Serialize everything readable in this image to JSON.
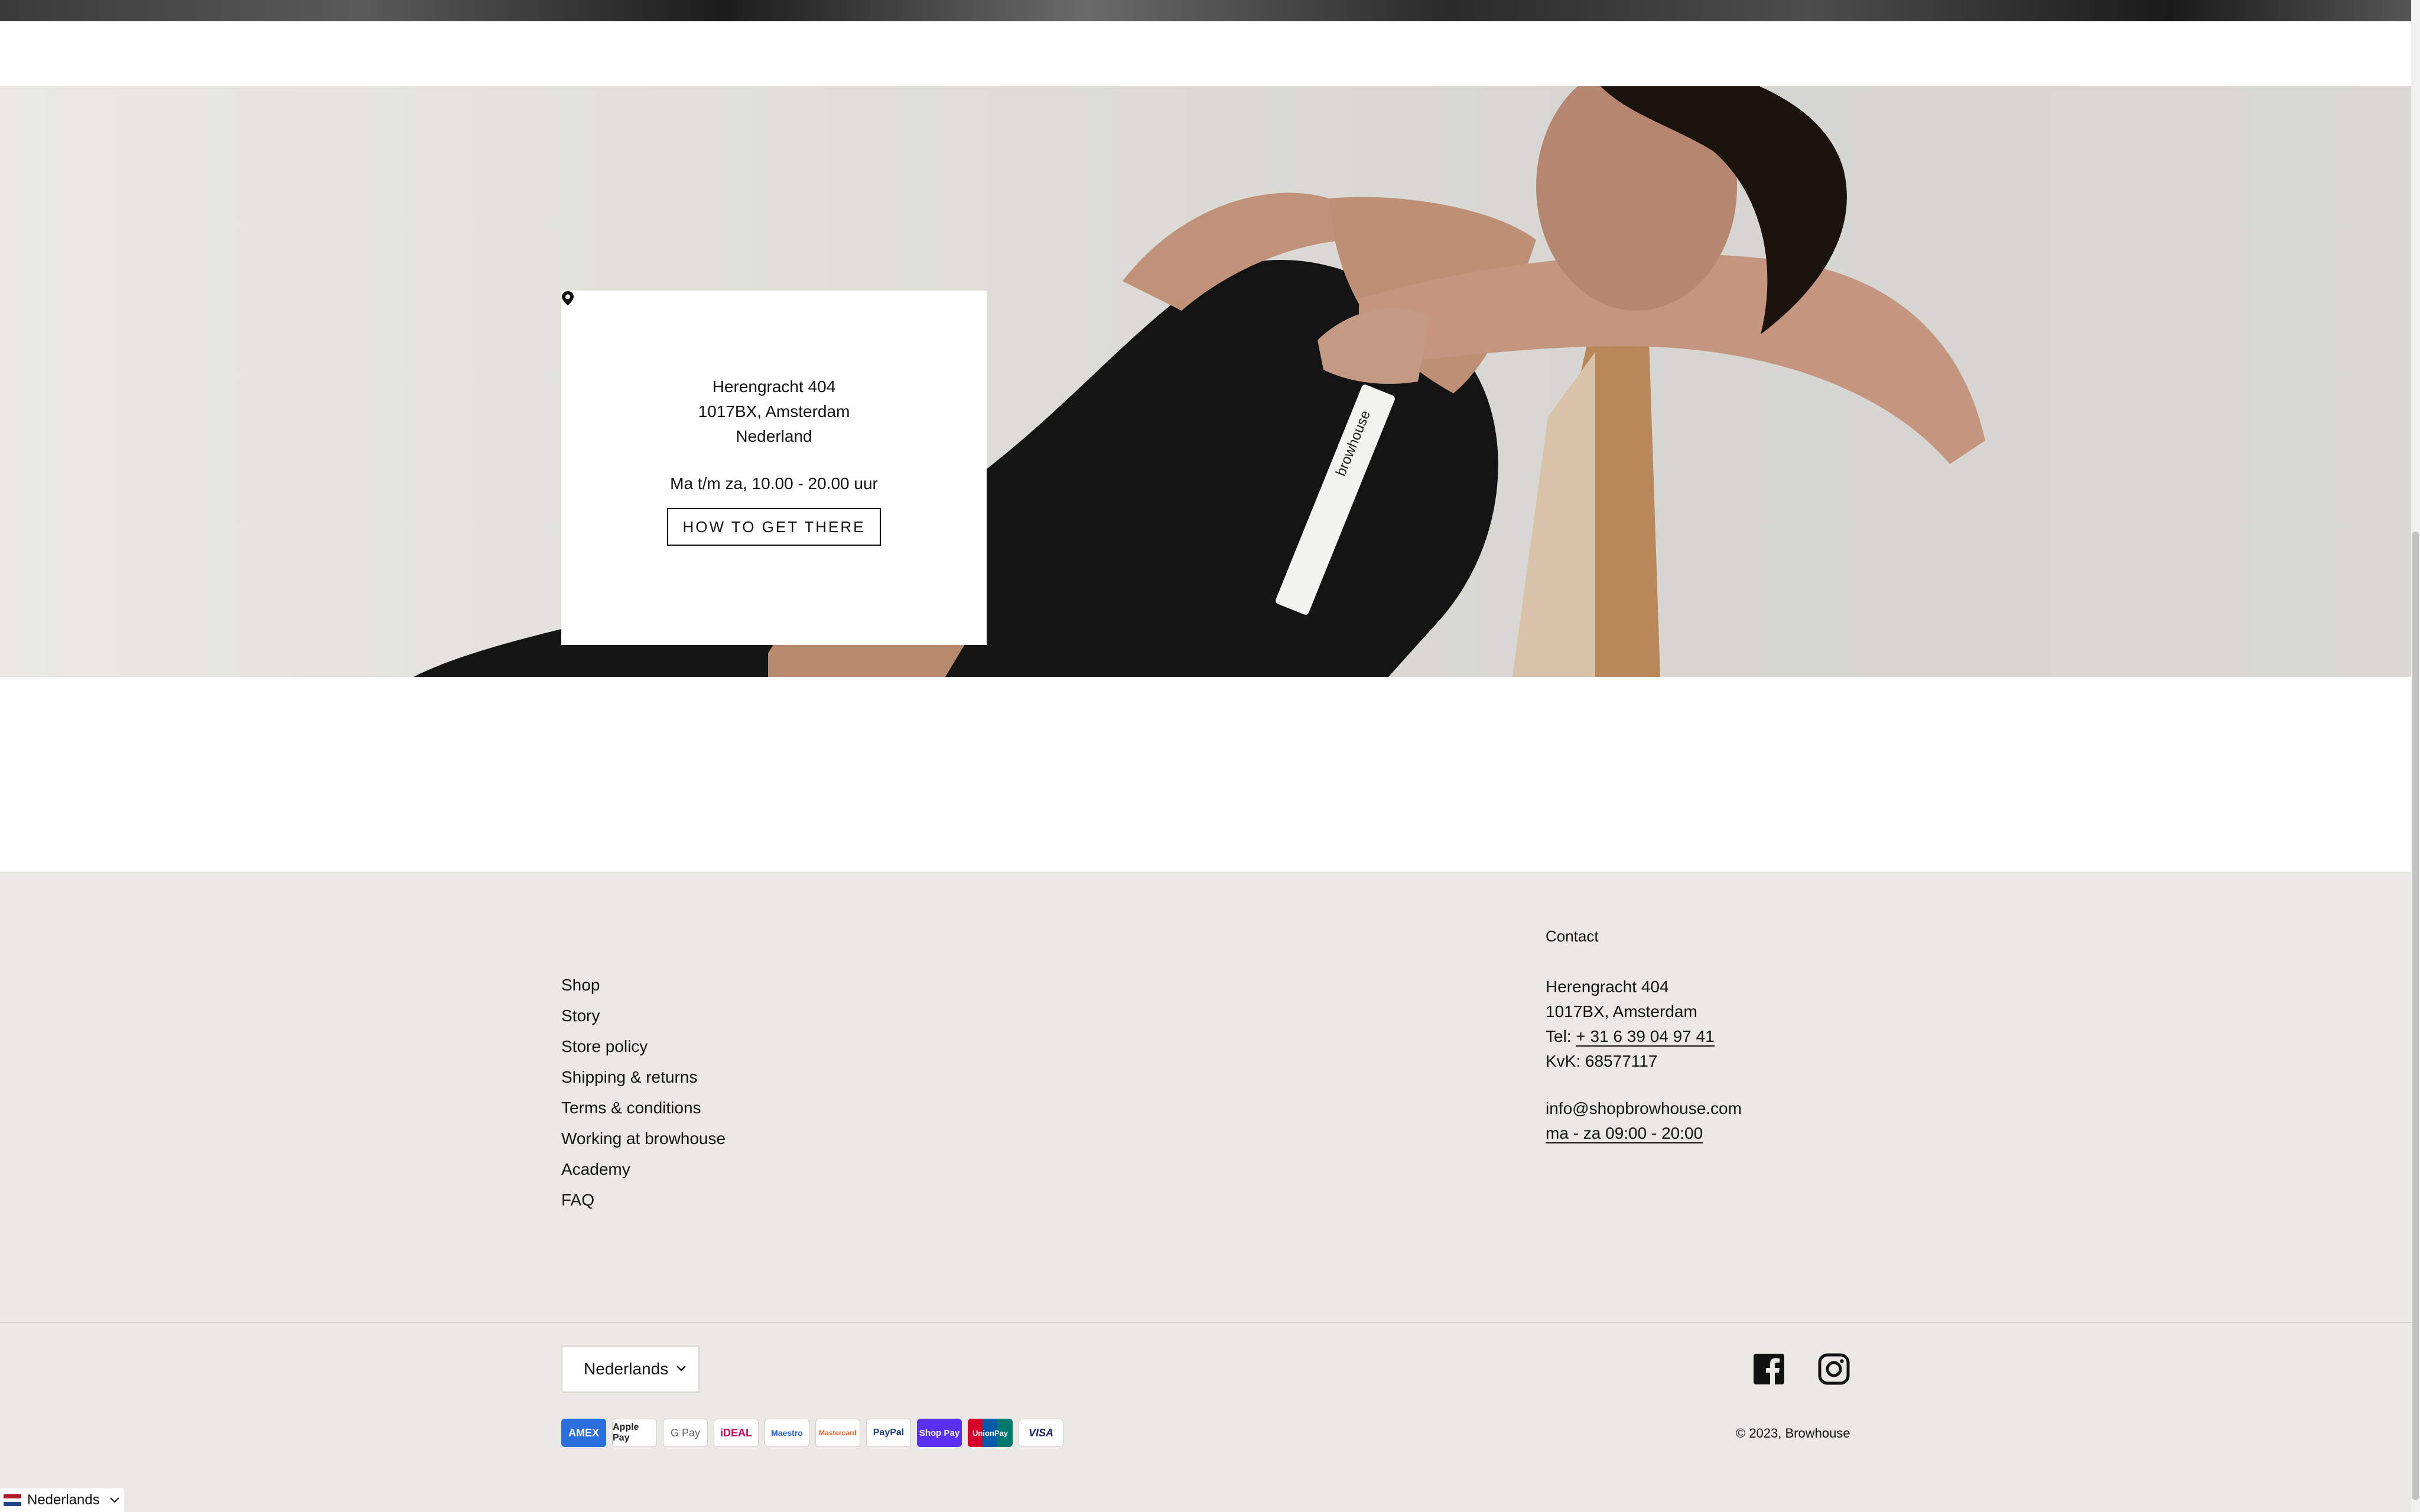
{
  "store": {
    "address_line1": "Herengracht 404",
    "address_line2": "1017BX, Amsterdam",
    "address_line3": "Nederland",
    "hours": "Ma t/m za, 10.00 - 20.00 uur",
    "directions_label": "How to get there"
  },
  "footer": {
    "links": [
      "Shop",
      "Story",
      "Store policy",
      "Shipping & returns",
      "Terms & conditions",
      "Working at browhouse",
      "Academy",
      "FAQ"
    ],
    "contact": {
      "heading": "Contact",
      "address_line1": "Herengracht 404",
      "address_line2": "1017BX, Amsterdam",
      "tel_label": "Tel:",
      "tel_value": "+ 31 6 39 04 97 41",
      "kvk": "KvK: 68577117",
      "email": "info@shopbrowhouse.com",
      "hours": "ma - za 09:00 - 20:00"
    },
    "language_select": "Nederlands",
    "payments": [
      "AMEX",
      "Apple Pay",
      "G Pay",
      "iDEAL",
      "Maestro",
      "Mastercard",
      "PayPal",
      "Shop Pay",
      "UnionPay",
      "VISA"
    ],
    "copyright": "© 2023, Browhouse"
  },
  "language_badge": "Nederlands",
  "icons": {
    "pin": "map-pin-icon",
    "facebook": "facebook-icon",
    "instagram": "instagram-icon",
    "chevron": "chevron-down-icon"
  }
}
